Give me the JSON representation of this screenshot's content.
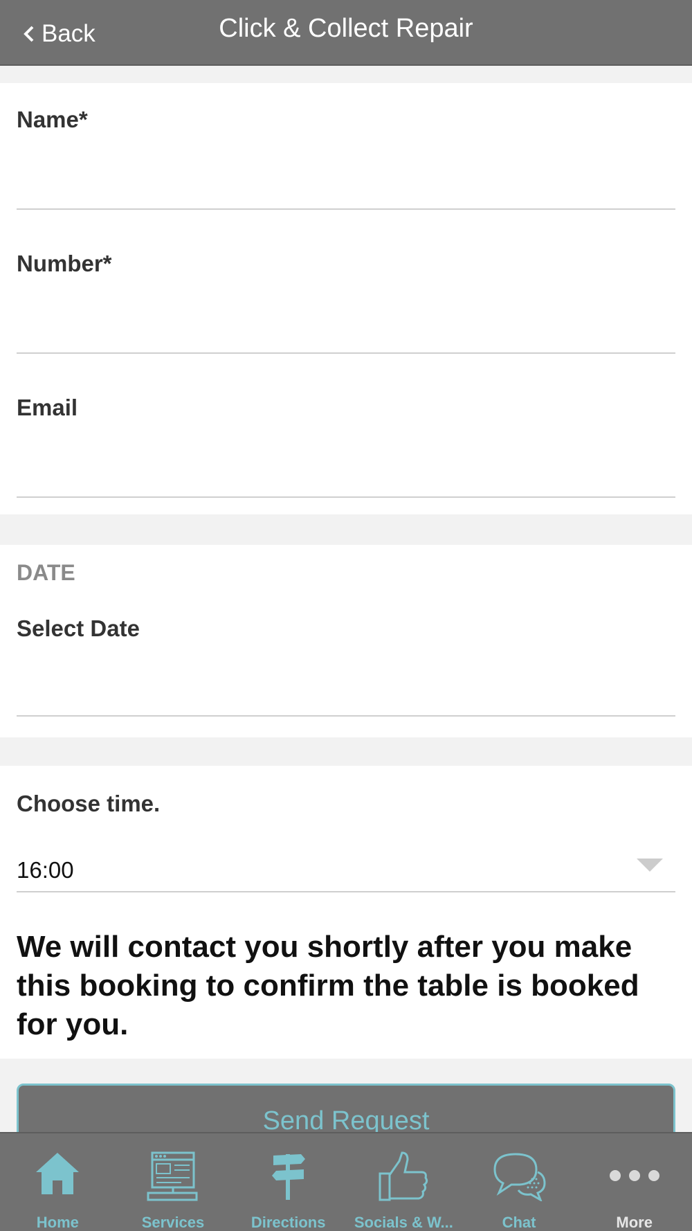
{
  "header": {
    "back_label": "Back",
    "title": "Click & Collect Repair"
  },
  "form": {
    "name_label": "Name*",
    "name_value": "",
    "number_label": "Number*",
    "number_value": "",
    "email_label": "Email",
    "email_value": "",
    "date_section_label": "DATE",
    "select_date_label": "Select Date",
    "select_date_value": "",
    "choose_time_label": "Choose time.",
    "time_value": "16:00"
  },
  "notice": "We will contact you shortly after you make this booking to confirm the table is booked for you.",
  "send_button": "Send Request",
  "tabbar": {
    "items": [
      {
        "label": "Home",
        "icon": "home-icon"
      },
      {
        "label": "Services",
        "icon": "computer-icon"
      },
      {
        "label": "Directions",
        "icon": "signpost-icon"
      },
      {
        "label": "Socials & W...",
        "icon": "thumbs-up-icon"
      },
      {
        "label": "Chat",
        "icon": "chat-bubbles-icon"
      },
      {
        "label": "More",
        "icon": "more-dots-icon"
      }
    ]
  },
  "colors": {
    "header_bg": "#717171",
    "accent": "#7cc3cd",
    "page_bg": "#f2f2f2"
  }
}
